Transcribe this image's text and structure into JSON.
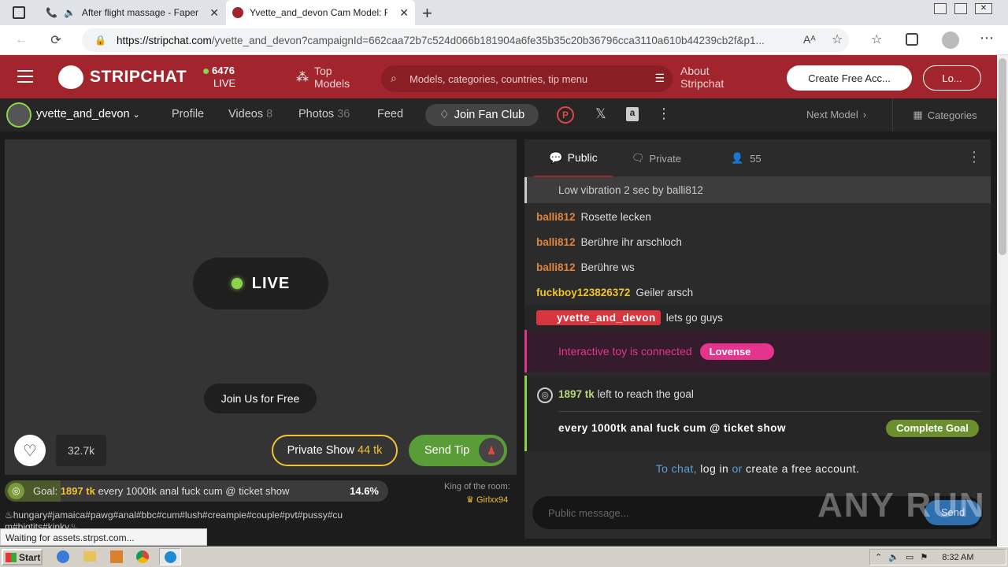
{
  "browser": {
    "tabs": [
      {
        "title": "After flight massage - Faper",
        "active": false
      },
      {
        "title": "Yvette_and_devon Cam Model: F",
        "active": true
      }
    ],
    "url_host": "https://stripchat.com",
    "url_rest": "/yvette_and_devon?campaignId=662caa72b7c524d066b181904a6fe35b35c20b36796cca3110a610b44239cb2f&p1..."
  },
  "header": {
    "logo": "STRIPCHAT",
    "live_count": "6476",
    "live_label": "LIVE",
    "top_models": "Top\nModels",
    "top_models_1": "Top",
    "top_models_2": "Models",
    "search_placeholder": "Models, categories, countries, tip menu",
    "about_1": "About",
    "about_2": "Stripchat",
    "create_account": "Create Free Acc...",
    "login": "Lo..."
  },
  "modelbar": {
    "username": "yvette_and_devon",
    "profile": "Profile",
    "videos": "Videos",
    "videos_count": "8",
    "photos": "Photos",
    "photos_count": "36",
    "feed": "Feed",
    "join_fan_club": "Join Fan Club",
    "next_model": "Next Model",
    "categories": "Categories"
  },
  "video": {
    "live_badge": "LIVE",
    "join_free": "Join Us for Free",
    "likes": "32.7k",
    "private_show": "Private Show",
    "private_price": "44 tk",
    "send_tip": "Send Tip"
  },
  "goal": {
    "label": "Goal:",
    "tokens": "1897",
    "tk": "tk",
    "text": "every 1000tk anal fuck cum @ ticket show",
    "percent": "14.6%",
    "king_label": "King of the room:",
    "king_name": "Girlxx94"
  },
  "tags": {
    "line1": "♨hungary#jamaica#pawg#anal#bbc#cum#lush#creampie#couple#pvt#pussy#cu",
    "line2": "m#bigtits#kinky♨"
  },
  "status_text": "Waiting for assets.strpst.com...",
  "chat": {
    "tab_public": "Public",
    "tab_private": "Private",
    "users": "55",
    "messages": [
      {
        "user": "",
        "text": "Low vibration 2 sec by balli812"
      },
      {
        "user": "balli812",
        "text": "Rosette lecken"
      },
      {
        "user": "balli812",
        "text": "Berühre ihr arschloch"
      },
      {
        "user": "balli812",
        "text": "Berühre ws"
      },
      {
        "user": "fuckboy123826372",
        "text": "Geiler arsch"
      },
      {
        "user": "yvette_and_devon",
        "text": "lets go guys"
      }
    ],
    "toy_text": "Interactive toy is connected",
    "toy_brand": "Lovense",
    "goal_tokens": "1897 tk",
    "goal_left": "left to reach the goal",
    "goal_text": "every 1000tk anal fuck cum @ ticket show",
    "complete_goal": "Complete Goal",
    "login_prompt_1": "To chat,",
    "login_prompt_2": "log in",
    "login_prompt_3": "or",
    "login_prompt_4": "create a free account.",
    "input_placeholder": "Public message...",
    "send": "Send"
  },
  "watermark": "ANY RUN",
  "taskbar": {
    "start": "Start",
    "time": "8:32 AM"
  },
  "colors": {
    "brand_red": "#a2252d",
    "live_green": "#8bd34b",
    "token_yellow": "#f1c232",
    "tip_green": "#5a9c38",
    "lovense_pink": "#e4348d"
  }
}
